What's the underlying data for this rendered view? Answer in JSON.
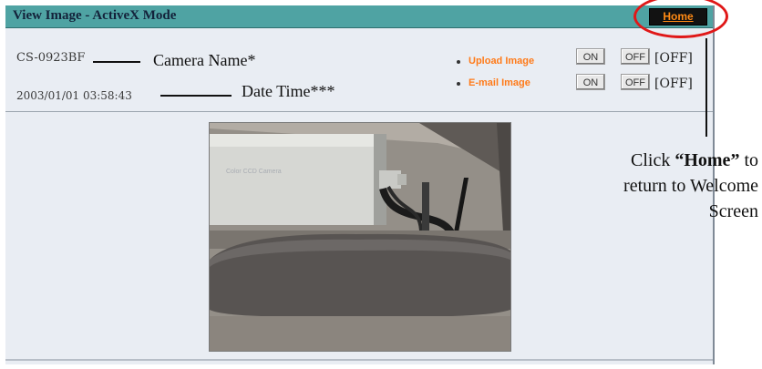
{
  "window": {
    "title": "View Image - ActiveX Mode",
    "home_label": "Home"
  },
  "info": {
    "camera_name": "CS-0923BF",
    "date_time": "2003/01/01 03:58:43"
  },
  "annotations": {
    "camera_name_label": "Camera Name*",
    "date_time_label": "Date Time***"
  },
  "controls": {
    "upload": {
      "label": "Upload Image",
      "on_label": "ON",
      "off_label": "OFF",
      "state": "[OFF]"
    },
    "email": {
      "label": "E-mail Image",
      "on_label": "ON",
      "off_label": "OFF",
      "state": "[OFF]"
    }
  },
  "camera_view": {
    "overlay_text": "Color CCD Camera"
  },
  "callout": {
    "line1_prefix": "Click ",
    "line1_home": "“Home”",
    "line1_suffix": " to",
    "line2": "return to Welcome",
    "line3": "Screen"
  },
  "colors": {
    "titlebar": "#4fa3a3",
    "home_text": "#ff8a14",
    "link": "#ff7a18",
    "highlight_ring": "#e01818"
  }
}
